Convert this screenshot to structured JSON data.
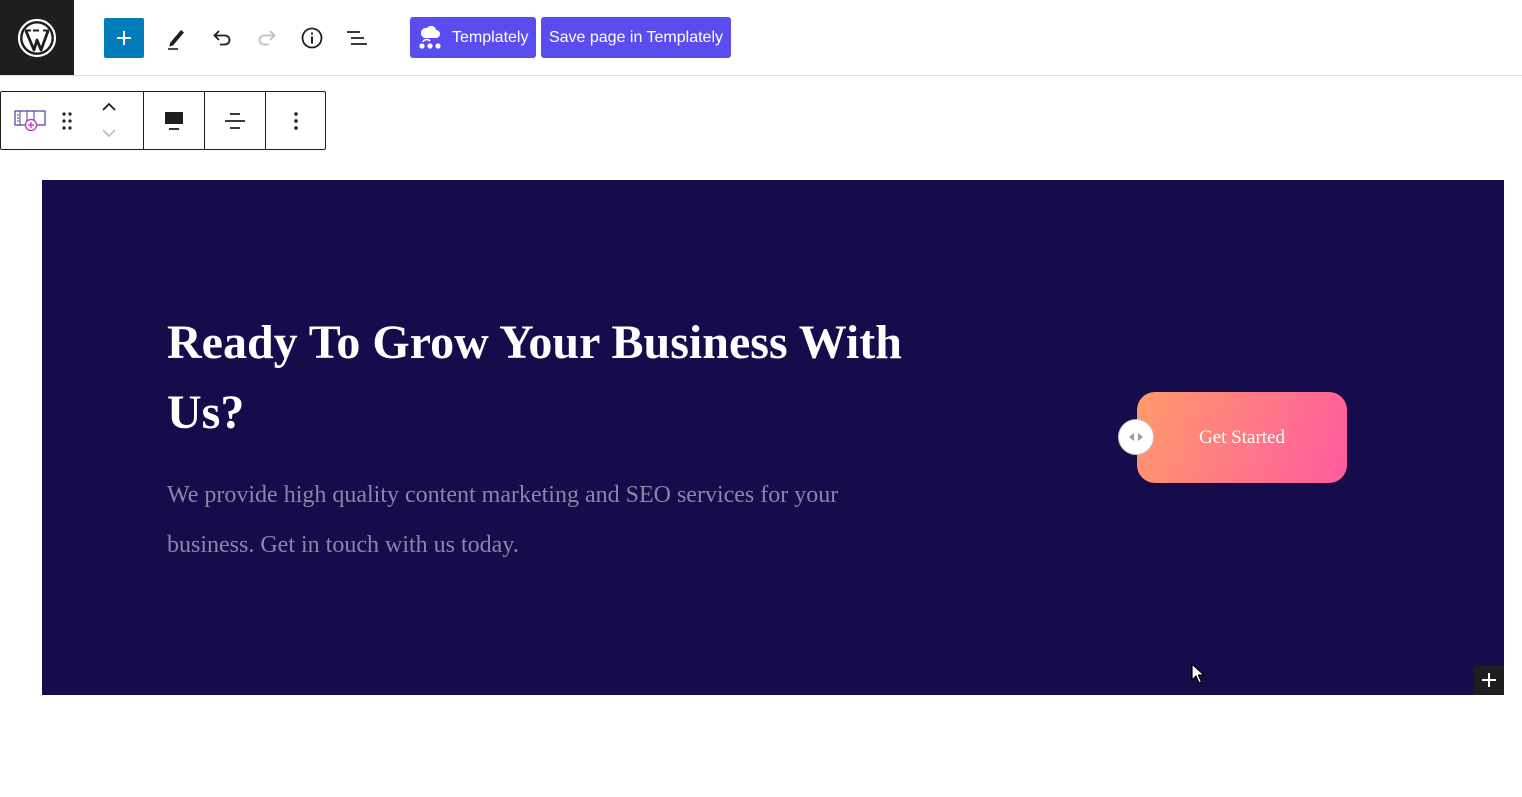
{
  "topbar": {
    "templately_label": "Templately",
    "save_templately_label": "Save page in Templately",
    "accent_color": "#007cba",
    "templately_color": "#5b4cf0",
    "icons": [
      "wordpress-icon",
      "plus-icon",
      "pencil-icon",
      "undo-icon",
      "redo-icon",
      "info-icon",
      "list-view-icon",
      "templately-icon"
    ]
  },
  "block_toolbar": {
    "icons": [
      "block-type-icon",
      "drag-handle-icon",
      "chevron-up-icon",
      "chevron-down-icon",
      "align-icon",
      "justify-icon",
      "more-options-icon"
    ]
  },
  "hero": {
    "title": "Ready To Grow Your Business With Us?",
    "description": "We provide high quality content marketing and SEO services for your business. Get in touch with us today.",
    "cta_label": "Get Started",
    "background_color": "#160c4c"
  }
}
